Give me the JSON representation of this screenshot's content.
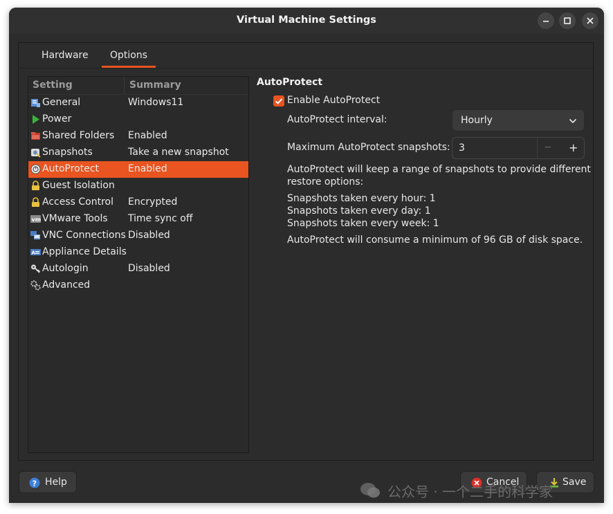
{
  "window": {
    "title": "Virtual Machine Settings"
  },
  "tabs": [
    {
      "label": "Hardware",
      "active": false
    },
    {
      "label": "Options",
      "active": true
    }
  ],
  "list": {
    "headers": {
      "setting": "Setting",
      "summary": "Summary"
    },
    "rows": [
      {
        "name": "General",
        "summary": "Windows11",
        "icon": "general-icon",
        "selected": false
      },
      {
        "name": "Power",
        "summary": "",
        "icon": "play-icon",
        "selected": false
      },
      {
        "name": "Shared Folders",
        "summary": "Enabled",
        "icon": "folder-icon",
        "selected": false
      },
      {
        "name": "Snapshots",
        "summary": "Take a new snapshot",
        "icon": "snapshot-icon",
        "selected": false
      },
      {
        "name": "AutoProtect",
        "summary": "Enabled",
        "icon": "autoprotect-icon",
        "selected": true
      },
      {
        "name": "Guest Isolation",
        "summary": "",
        "icon": "lock-icon",
        "selected": false
      },
      {
        "name": "Access Control",
        "summary": "Encrypted",
        "icon": "lock-icon",
        "selected": false
      },
      {
        "name": "VMware Tools",
        "summary": "Time sync off",
        "icon": "vm-icon",
        "selected": false
      },
      {
        "name": "VNC Connections",
        "summary": "Disabled",
        "icon": "vnc-icon",
        "selected": false
      },
      {
        "name": "Appliance Details",
        "summary": "",
        "icon": "appliance-icon",
        "selected": false
      },
      {
        "name": "Autologin",
        "summary": "Disabled",
        "icon": "key-icon",
        "selected": false
      },
      {
        "name": "Advanced",
        "summary": "",
        "icon": "gears-icon",
        "selected": false
      }
    ]
  },
  "panel": {
    "title": "AutoProtect",
    "enable_label": "Enable AutoProtect",
    "enable_checked": true,
    "interval_label": "AutoProtect interval:",
    "interval_value": "Hourly",
    "max_label": "Maximum AutoProtect snapshots:",
    "max_value": "3",
    "minus": "−",
    "plus": "+",
    "desc_line1": "AutoProtect will keep a range of snapshots to provide different",
    "desc_line2": "restore options:",
    "hourly": "Snapshots taken every hour: 1",
    "daily": "Snapshots taken every day: 1",
    "weekly": "Snapshots taken every week: 1",
    "consume": "AutoProtect will consume a minimum of 96 GB of disk space."
  },
  "buttons": {
    "help": "Help",
    "cancel": "Cancel",
    "save": "Save"
  },
  "watermark": {
    "text": "公众号 · 一个二手的科学家"
  },
  "colors": {
    "accent": "#e95420",
    "window_bg": "#2c2c2c"
  }
}
